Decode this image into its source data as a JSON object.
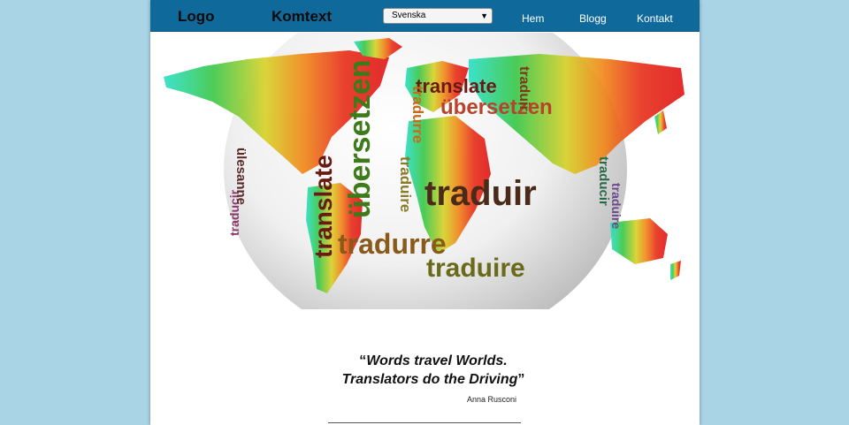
{
  "header": {
    "logo": "Logo",
    "brand": "Komtext",
    "language_select": {
      "selected": "Svenska"
    },
    "nav": [
      {
        "label": "Hem"
      },
      {
        "label": "Blogg"
      },
      {
        "label": "Kontakt"
      }
    ]
  },
  "hero": {
    "words": [
      "translate",
      "übersetzen",
      "translate",
      "übersetzen",
      "traduir",
      "tradurre",
      "traduire",
      "traduir",
      "traduire",
      "tradurre",
      "traducir",
      "traduire",
      "traducir",
      "ülesanne"
    ]
  },
  "quote": {
    "open_mark": "“",
    "line1": "Words travel Worlds.",
    "line2": "Translators do the Driving",
    "close_mark": "”",
    "author": "Anna Rusconi"
  },
  "colors": {
    "background": "#a9d4e6",
    "navbar": "#0f6a9b",
    "nav_text": "#ffffff"
  }
}
